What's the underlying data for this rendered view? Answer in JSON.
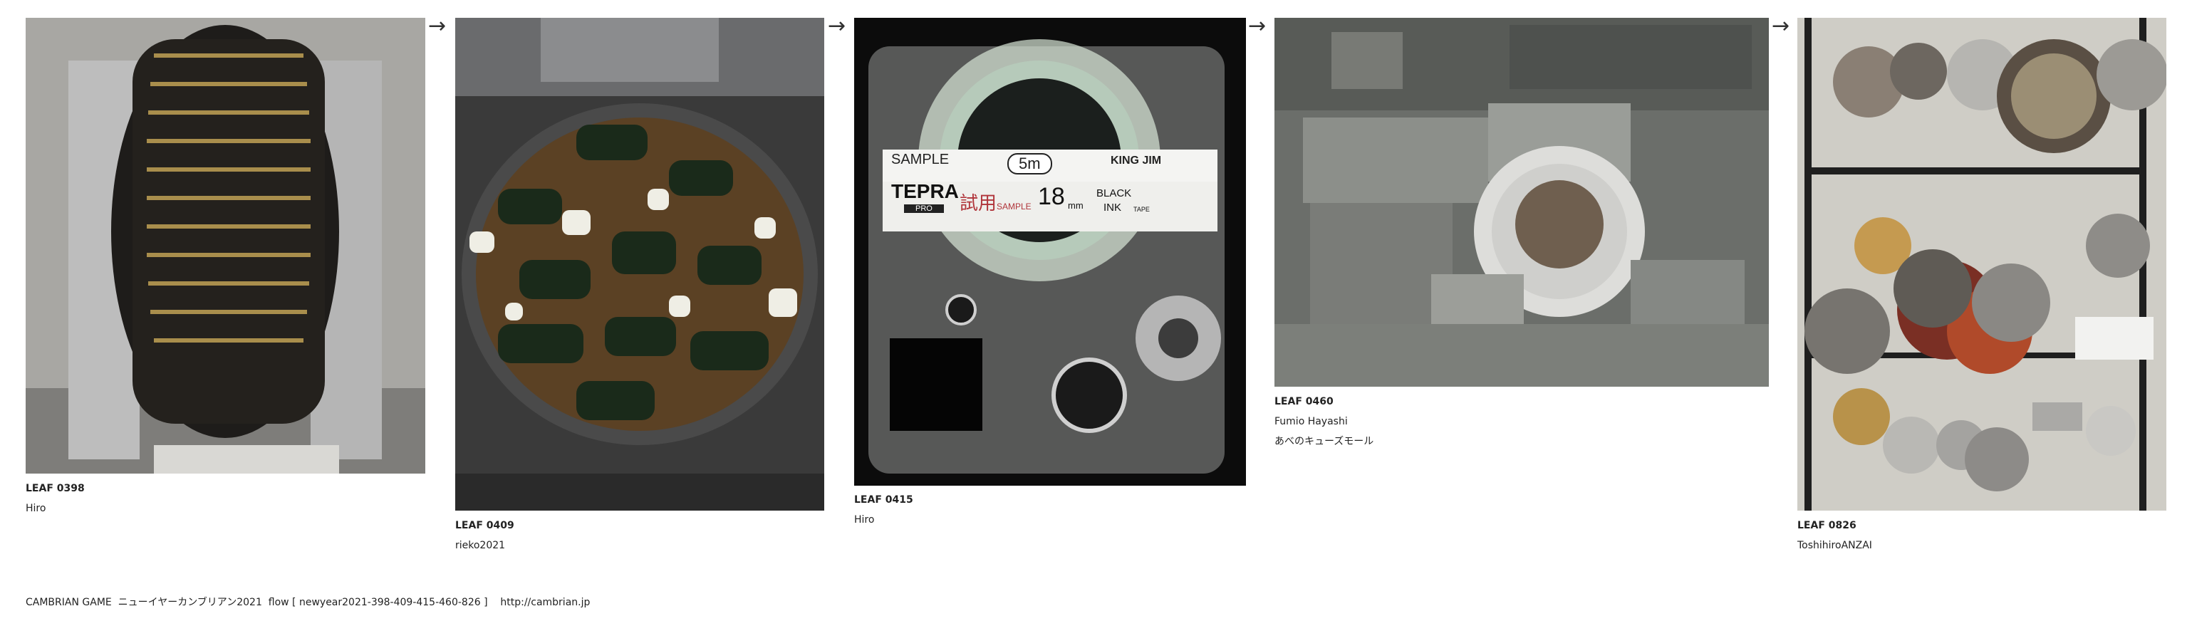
{
  "leaves": [
    {
      "leaf": "LEAF 0398",
      "author": "Hiro",
      "title": ""
    },
    {
      "leaf": "LEAF 0409",
      "author": "rieko2021",
      "title": ""
    },
    {
      "leaf": "LEAF 0415",
      "author": "Hiro",
      "title": ""
    },
    {
      "leaf": "LEAF 0460",
      "author": "Fumio Hayashi",
      "title": "あべのキューズモール"
    },
    {
      "leaf": "LEAF 0826",
      "author": "ToshihiroANZAI",
      "title": ""
    }
  ],
  "tape": {
    "sample": "SAMPLE",
    "length": "5m",
    "brand": "KING JIM",
    "product": "TEPRA",
    "product_sub": "PRO",
    "trial": "試用",
    "trial_sub": "SAMPLE",
    "width": "18",
    "unit": "mm",
    "ink": "BLACK",
    "ink2": "INK",
    "tape_word": "TAPE"
  },
  "arrow": "→",
  "footer": {
    "text": "CAMBRIAN GAME  ニューイヤーカンブリアン2021  flow [ newyear2021-398-409-415-460-826 ]",
    "link": "http://cambrian.jp"
  }
}
